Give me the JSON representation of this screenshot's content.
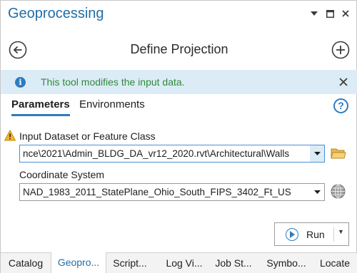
{
  "titlebar": {
    "title": "Geoprocessing"
  },
  "header": {
    "tool_title": "Define Projection"
  },
  "infobar": {
    "message": "This tool modifies the input data."
  },
  "tabs": {
    "parameters": "Parameters",
    "environments": "Environments"
  },
  "params": {
    "input_label": "Input Dataset or Feature Class",
    "input_value": "nce\\2021\\Admin_BLDG_DA_vr12_2020.rvt\\Architectural\\Walls",
    "coord_label": "Coordinate System",
    "coord_value": "NAD_1983_2011_StatePlane_Ohio_South_FIPS_3402_Ft_US"
  },
  "run": {
    "label": "Run"
  },
  "bottom_tabs": [
    "Catalog",
    "Geopro...",
    "Script...",
    "Log Vi...",
    "Job St...",
    "Symbo...",
    "Locate"
  ],
  "colors": {
    "accent": "#1f6ea8",
    "info_bg": "#dcecf7",
    "info_text": "#2f8a3a",
    "warning": "#e8a317"
  }
}
